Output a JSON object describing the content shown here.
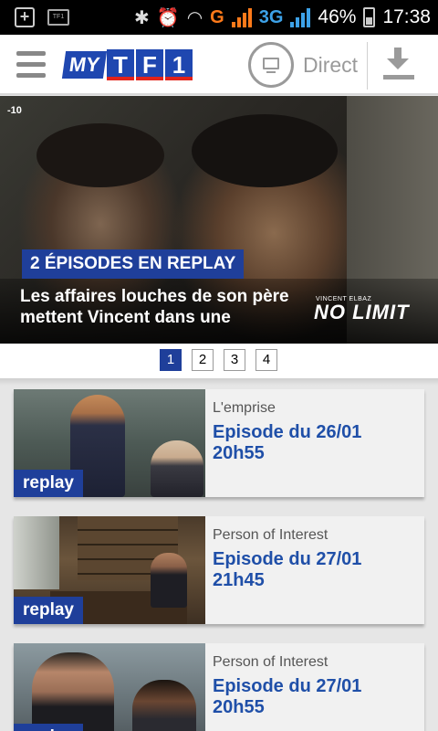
{
  "status_bar": {
    "battery": "46%",
    "time": "17:38",
    "network_g": "G",
    "network_3g": "3G",
    "icons": [
      "add-icon",
      "tf1-notification-icon",
      "bluetooth-icon",
      "alarm-icon",
      "wifi-icon",
      "signal-icon",
      "battery-icon"
    ]
  },
  "header": {
    "logo_my": "MY",
    "logo_letters": [
      "T",
      "F",
      "1"
    ],
    "direct_label": "Direct",
    "icons": [
      "menu-icon",
      "tv-icon",
      "download-icon"
    ]
  },
  "hero": {
    "channel_badge": "-10",
    "badge": "2 ÉPISODES EN REPLAY",
    "text": "Les affaires louches de son père mettent Vincent dans une",
    "brand_small": "VINCENT ELBAZ",
    "brand_big": "NO LIMIT"
  },
  "pagination": {
    "pages": [
      "1",
      "2",
      "3",
      "4"
    ],
    "active": "1"
  },
  "cards": [
    {
      "replay": "replay",
      "show": "L'emprise",
      "episode": "Episode du 26/01",
      "time": "20h55"
    },
    {
      "replay": "replay",
      "show": "Person of Interest",
      "episode": "Episode du 27/01",
      "time": "21h45"
    },
    {
      "replay": "replay",
      "show": "Person of Interest",
      "episode": "Episode du 27/01",
      "time": "20h55"
    }
  ],
  "colors": {
    "brand_blue": "#1f3f9a",
    "link_blue": "#1f4fa8",
    "logo_red": "#e2231a",
    "signal_orange": "#ff7a1a",
    "signal_blue": "#3da2e8"
  }
}
